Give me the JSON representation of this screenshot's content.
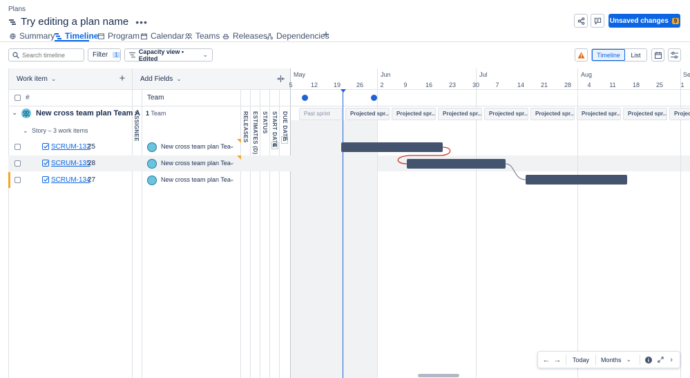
{
  "breadcrumb": "Plans",
  "plan_title": "Try editing a plan name",
  "header": {
    "unsaved_label": "Unsaved changes",
    "unsaved_count": "9"
  },
  "tabs": [
    {
      "label": "Summary"
    },
    {
      "label": "Timeline"
    },
    {
      "label": "Program"
    },
    {
      "label": "Calendar"
    },
    {
      "label": "Teams"
    },
    {
      "label": "Releases"
    },
    {
      "label": "Dependencies"
    }
  ],
  "toolbar": {
    "search_placeholder": "Search timeline",
    "filter_label": "Filter",
    "filter_count": "1",
    "view_label": "Capacity view • Edited",
    "timeline_toggle": "Timeline",
    "list_toggle": "List"
  },
  "grid": {
    "work_item_header": "Work item",
    "add_fields_header": "Add Fields",
    "hash_header": "#",
    "team_header": "Team",
    "team_row_label": "New cross team plan Team A",
    "team_count_num": "1",
    "team_count_text": "Team",
    "story_group": "Story – 3 work items",
    "vertical_headers": [
      "ASSIGNEE",
      "RELEASES",
      "ESTIMATES (D)",
      "STATUS",
      "START DATE",
      "DUE DATE"
    ],
    "date_badge": "D"
  },
  "rows": [
    {
      "key": "SCRUM-132",
      "number": "25",
      "team": "New cross team plan Tea"
    },
    {
      "key": "SCRUM-135",
      "number": "28",
      "team": "New cross team plan Tea"
    },
    {
      "key": "SCRUM-134",
      "number": "27",
      "team": "New cross team plan Tea"
    }
  ],
  "timeline": {
    "months": [
      "May",
      "Jun",
      "Jul",
      "Aug",
      "Se"
    ],
    "ticks": [
      "5",
      "12",
      "19",
      "26",
      "2",
      "9",
      "16",
      "23",
      "30",
      "7",
      "14",
      "21",
      "28",
      "4",
      "11",
      "18",
      "25",
      "1"
    ],
    "sprints": [
      "Past sprint",
      "Projected spr...",
      "Projected spr...",
      "Projected spr...",
      "Projected spr...",
      "Projected spr...",
      "Projected spr...",
      "Projected spr...",
      "Projected spr...",
      "Projec"
    ]
  },
  "footer": {
    "today_label": "Today",
    "scale_label": "Months"
  },
  "colors": {
    "accent": "#0c66e4",
    "bar": "#44546f",
    "badge": "#f5a623",
    "today_line": "#1d62d8",
    "dependency": "#c9372c"
  }
}
